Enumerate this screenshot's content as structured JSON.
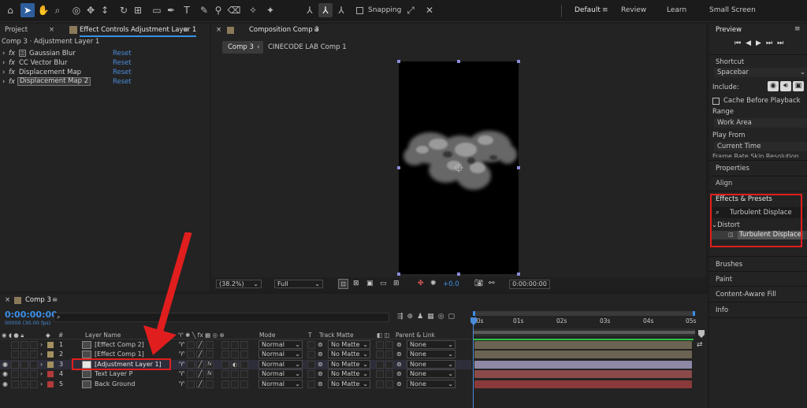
{
  "workspaces": [
    "Default",
    "Review",
    "Learn",
    "Small Screen"
  ],
  "snapping_label": "Snapping",
  "project_panel": {
    "tab": "Project",
    "effect_controls_tab": "Effect Controls Adjustment Layer 1",
    "subtitle": "Comp 3 · Adjustment Layer 1"
  },
  "effects": [
    {
      "name": "Gaussian Blur",
      "reset": "Reset"
    },
    {
      "name": "CC Vector Blur",
      "reset": "Reset"
    },
    {
      "name": "Displacement Map",
      "reset": "Reset"
    },
    {
      "name": "Displacement Map 2",
      "reset": "Reset"
    }
  ],
  "composition_panel": {
    "tab": "Composition Comp 3",
    "crumb_active": "Comp 3",
    "crumb_other": "CINECODE LAB Comp 1"
  },
  "viewer_bar": {
    "zoom": "(38.2%)",
    "resolution": "Full",
    "exposure": "+0.0",
    "timecode": "0:00:00:00"
  },
  "timeline": {
    "tab": "Comp 3",
    "timecode": "0:00:00:00",
    "fps": "00000 (30.00 fps)",
    "search_placeholder": "",
    "columns": {
      "num": "#",
      "layer_name": "Layer Name",
      "mode": "Mode",
      "t": "T",
      "track_matte": "Track Matte",
      "parent": "Parent & Link"
    },
    "ruler": [
      "00s",
      "01s",
      "02s",
      "03s",
      "04s",
      "05s"
    ],
    "layers": [
      {
        "num": "1",
        "name": "[Effect Comp 2]",
        "mode": "Normal",
        "matte": "No Matte",
        "parent": "None",
        "label_color": "#a38f5f",
        "bar_color": "#6b6452"
      },
      {
        "num": "2",
        "name": "[Effect Comp 1]",
        "mode": "Normal",
        "matte": "No Matte",
        "parent": "None",
        "label_color": "#a38f5f",
        "bar_color": "#6b6452"
      },
      {
        "num": "3",
        "name": "[Adjustment Layer 1]",
        "mode": "Normal",
        "matte": "No Matte",
        "parent": "None",
        "label_color": "#a38f5f",
        "bar_color": "#8e88a6"
      },
      {
        "num": "4",
        "name": "Text Layer P",
        "mode": "Normal",
        "matte": "No Matte",
        "parent": "None",
        "label_color": "#b33a3a",
        "bar_color": "#8a4a4a"
      },
      {
        "num": "5",
        "name": "Back Ground",
        "mode": "Normal",
        "matte": "No Matte",
        "parent": "None",
        "label_color": "#b33a3a",
        "bar_color": "#8a3a3a"
      }
    ]
  },
  "preview_panel": {
    "title": "Preview",
    "shortcut_label": "Shortcut",
    "shortcut_value": "Spacebar",
    "include_label": "Include:",
    "cache_label": "Cache Before Playback",
    "range_label": "Range",
    "range_value": "Work Area",
    "play_from_label": "Play From",
    "play_from_value": "Current Time",
    "cut_row": "Frame Rate    Skip    Resolution"
  },
  "right_panels": {
    "properties": "Properties",
    "align": "Align",
    "effects_presets": "Effects & Presets",
    "search_value": "Turbulent Displace",
    "category": "Distort",
    "result": "Turbulent Displace",
    "brushes": "Brushes",
    "paint": "Paint",
    "content_aware_fill": "Content-Aware Fill",
    "info": "Info"
  },
  "colors": {
    "accent_blue": "#3b8fe8",
    "highlight_red": "#e01e1e",
    "selected_blue": "#2e5f9c"
  }
}
